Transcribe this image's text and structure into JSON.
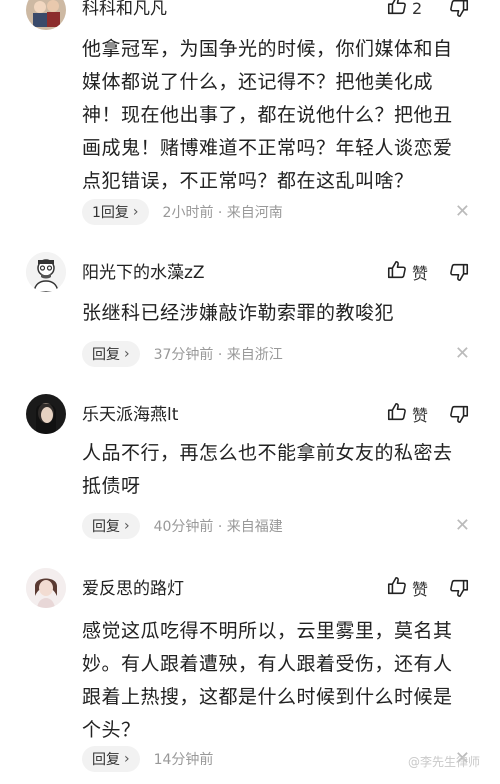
{
  "comments": [
    {
      "username": "科科和凡凡",
      "like_count": "2",
      "content_lines": [
        "他拿冠军，为国争光的时候，你们媒体和自",
        "媒体都说了什么，还记得不？把他美化成",
        "神！现在他出事了，都在说他什么？把他丑",
        "画成鬼！赌博难道不正常吗？年轻人谈恋爱",
        "点犯错误，不正常吗？都在这乱叫啥？"
      ],
      "reply_label": "1回复",
      "reply_chevron": "›",
      "time_location": "2小时前 · 来自河南",
      "close": "✕"
    },
    {
      "username": "阳光下的水藻zZ",
      "like_count": "赞",
      "content_lines": [
        "张继科已经涉嫌敲诈勒索罪的教唆犯"
      ],
      "reply_label": "回复",
      "reply_chevron": "›",
      "time_location": "37分钟前 · 来自浙江",
      "close": "✕"
    },
    {
      "username": "乐天派海燕lt",
      "like_count": "赞",
      "content_lines": [
        "人品不行，再怎么也不能拿前女友的私密去",
        "抵债呀"
      ],
      "reply_label": "回复",
      "reply_chevron": "›",
      "time_location": "40分钟前 · 来自福建",
      "close": "✕"
    },
    {
      "username": "爱反思的路灯",
      "like_count": "赞",
      "content_lines": [
        "感觉这瓜吃得不明所以，云里雾里，莫名其",
        "妙。有人跟着遭殃，有人跟着受伤，还有人",
        "跟着上热搜，这都是什么时候到什么时候是",
        "个头？"
      ],
      "reply_label": "回复",
      "reply_chevron": "›",
      "time_location": "14分钟前",
      "close": "✕"
    }
  ],
  "watermark": "@李先生律师",
  "icons": {
    "like": "thumbs-up-icon",
    "dislike": "thumbs-down-icon",
    "close": "close-icon"
  }
}
